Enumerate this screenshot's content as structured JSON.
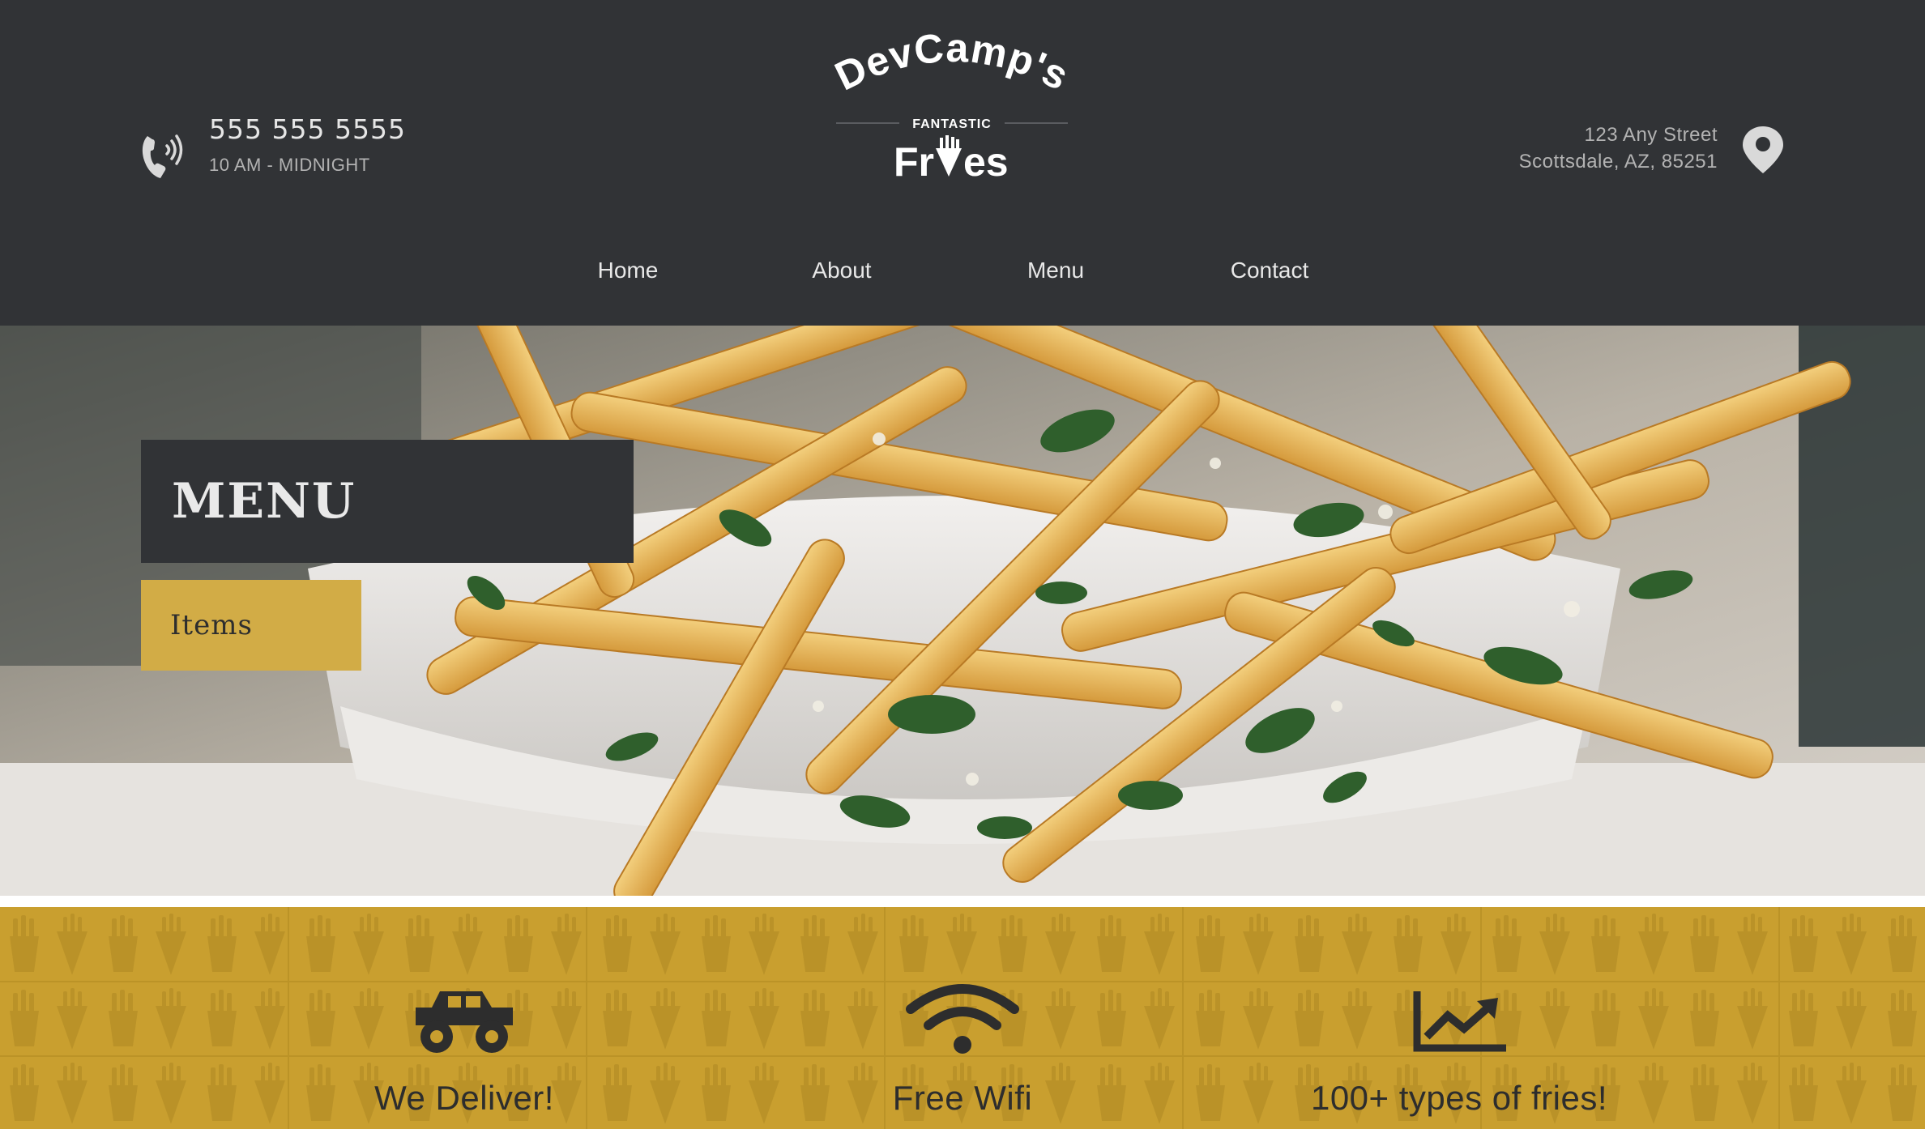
{
  "header": {
    "phone": {
      "number": "555 555 5555",
      "hours": "10 AM - MIDNIGHT",
      "icon": "phone-icon"
    },
    "logo": {
      "line1": "DevCamp's",
      "tagline": "FANTASTIC",
      "line2a": "Fr",
      "line2b": "es"
    },
    "address": {
      "street": "123 Any Street",
      "city": "Scottsdale, AZ, 85251",
      "icon": "map-pin-icon"
    }
  },
  "nav": {
    "items": [
      {
        "label": "Home"
      },
      {
        "label": "About"
      },
      {
        "label": "Menu"
      },
      {
        "label": "Contact"
      }
    ]
  },
  "hero": {
    "title": "MENU",
    "button_label": "Items"
  },
  "features": [
    {
      "label": "We Deliver!",
      "icon": "truck-icon"
    },
    {
      "label": "Free Wifi",
      "icon": "wifi-icon"
    },
    {
      "label": "100+ types of fries!",
      "icon": "chart-icon"
    }
  ],
  "colors": {
    "dark": "#313336",
    "accent_gold": "#d2ac46",
    "feature_band": "#c99f2f"
  }
}
